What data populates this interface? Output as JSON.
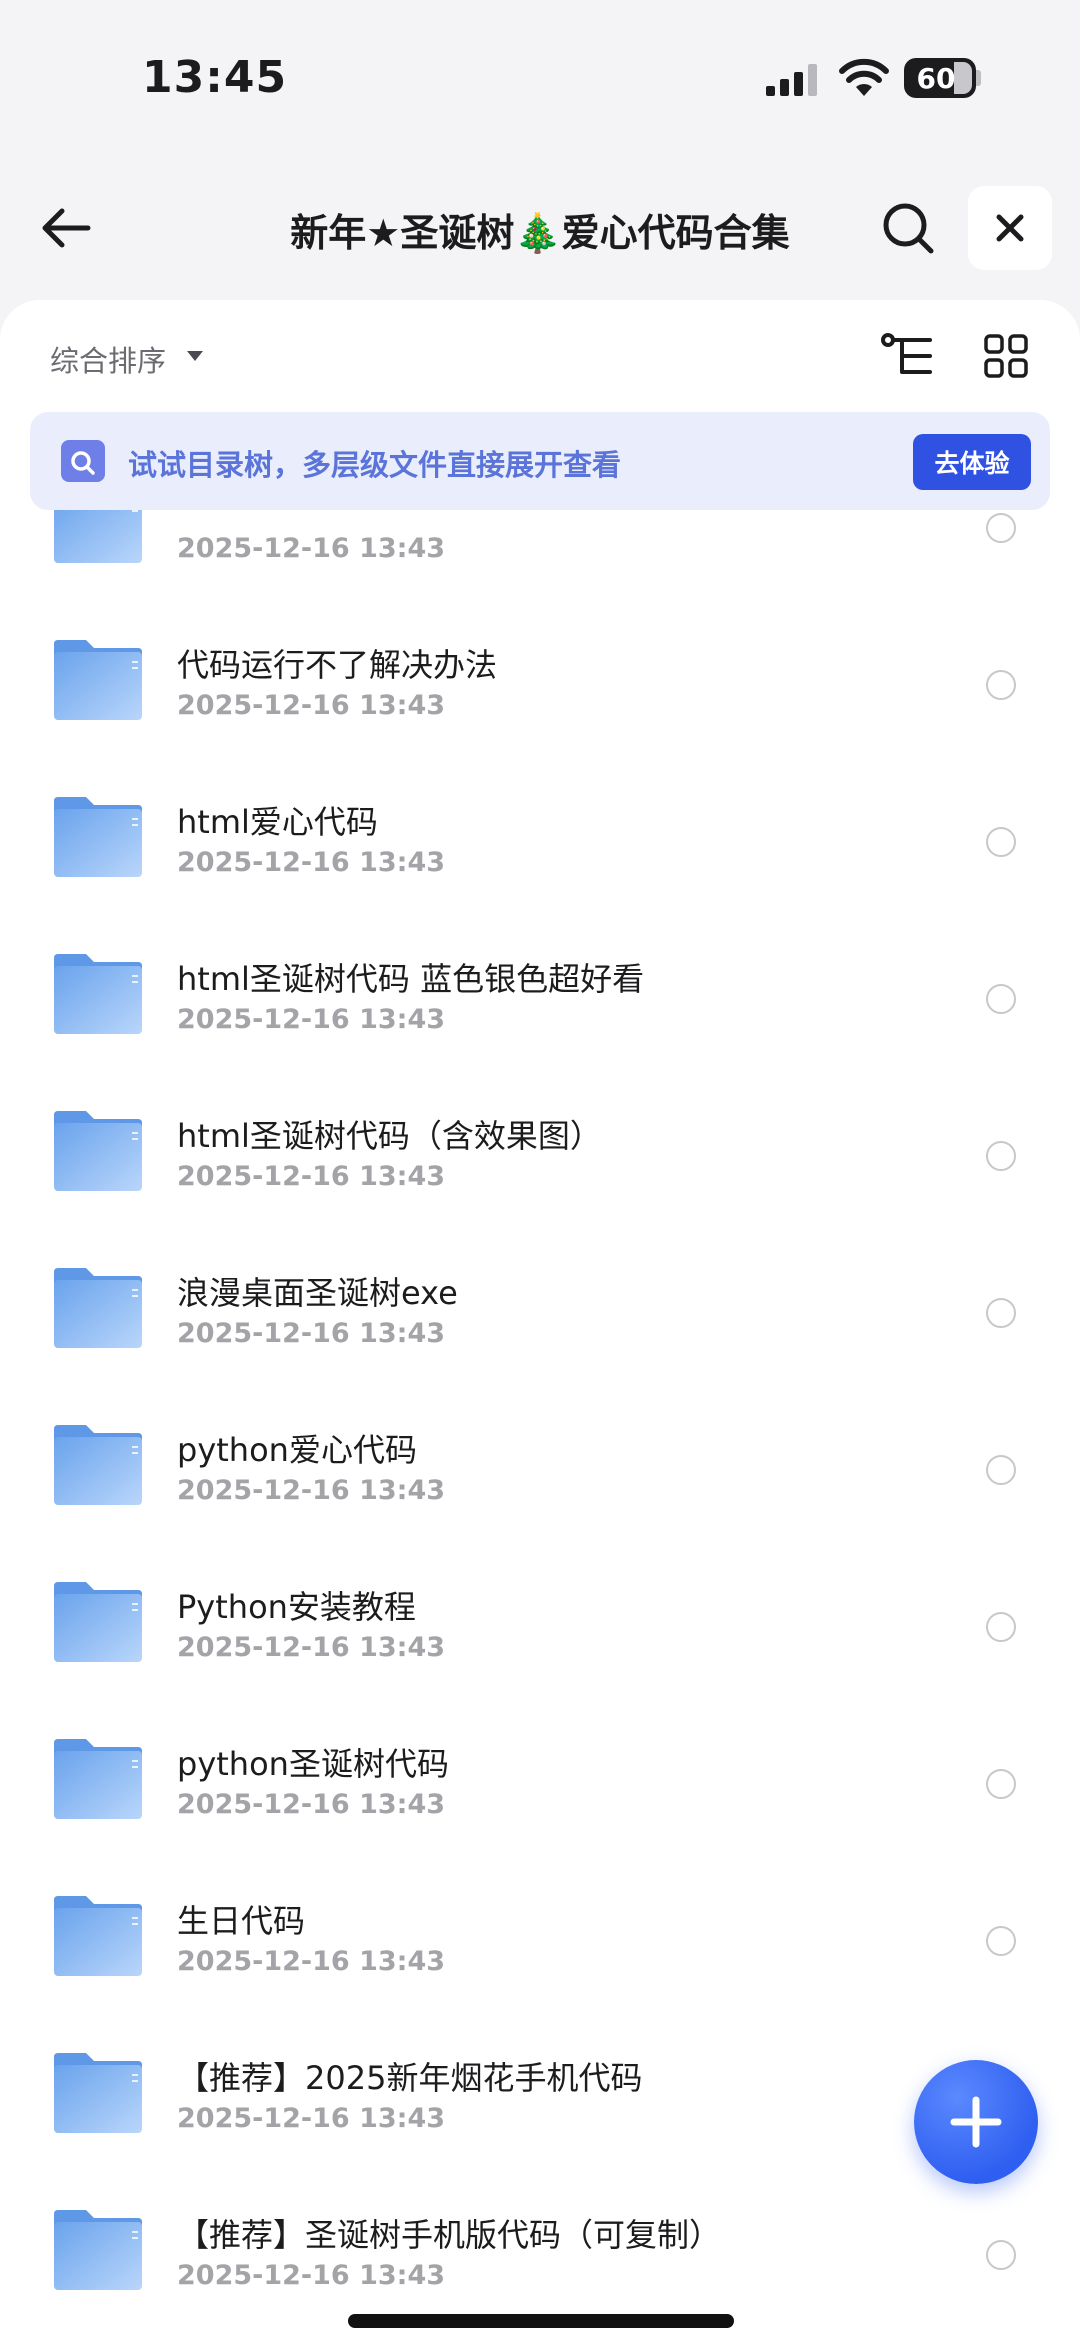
{
  "status_bar": {
    "time": "13:45",
    "battery": "60"
  },
  "nav": {
    "title": "新年★圣诞树🎄爱心代码合集"
  },
  "toolbar": {
    "sort_label": "综合排序"
  },
  "tip": {
    "text": "试试目录树，多层级文件直接展开查看",
    "button": "去体验"
  },
  "files": [
    {
      "name": "",
      "date": "2025-12-16 13:43"
    },
    {
      "name": "代码运行不了解决办法",
      "date": "2025-12-16 13:43"
    },
    {
      "name": "html爱心代码",
      "date": "2025-12-16 13:43"
    },
    {
      "name": "html圣诞树代码 蓝色银色超好看",
      "date": "2025-12-16 13:43"
    },
    {
      "name": "html圣诞树代码（含效果图）",
      "date": "2025-12-16 13:43"
    },
    {
      "name": "浪漫桌面圣诞树exe",
      "date": "2025-12-16 13:43"
    },
    {
      "name": "python爱心代码",
      "date": "2025-12-16 13:43"
    },
    {
      "name": "Python安装教程",
      "date": "2025-12-16 13:43"
    },
    {
      "name": "python圣诞树代码",
      "date": "2025-12-16 13:43"
    },
    {
      "name": "生日代码",
      "date": "2025-12-16 13:43"
    },
    {
      "name": "【推荐】2025新年烟花手机代码",
      "date": "2025-12-16 13:43"
    },
    {
      "name": "【推荐】圣诞树手机版代码（可复制）",
      "date": "2025-12-16 13:43"
    }
  ],
  "colors": {
    "accent": "#2f52e3",
    "tip_bg": "#eaedfb",
    "folder": "#7fb2f0"
  }
}
